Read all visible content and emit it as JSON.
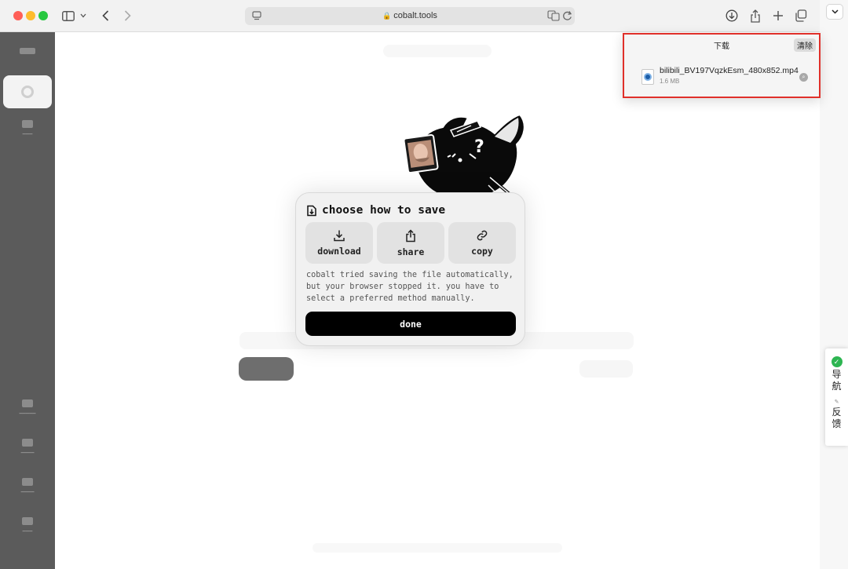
{
  "browser": {
    "url": "cobalt.tools"
  },
  "downloads": {
    "title": "下载",
    "clear_label": "清除",
    "items": [
      {
        "name": "bilibili_BV197VqzkEsm_480x852.mp4",
        "size": "1.6 MB"
      }
    ]
  },
  "dialog": {
    "title": "choose how to save",
    "options": [
      {
        "label": "download",
        "icon": "download-icon"
      },
      {
        "label": "share",
        "icon": "share-icon"
      },
      {
        "label": "copy",
        "icon": "link-icon"
      }
    ],
    "message": "cobalt tried saving the file automatically, but your browser stopped it. you have to select a preferred method manually.",
    "done_label": "done"
  },
  "side_widget": {
    "nav_label": "导航",
    "feedback_label": "反馈"
  },
  "colors": {
    "dialog_bg": "#f1f1f1",
    "done_button": "#000000",
    "highlight_border": "#e0302a"
  }
}
